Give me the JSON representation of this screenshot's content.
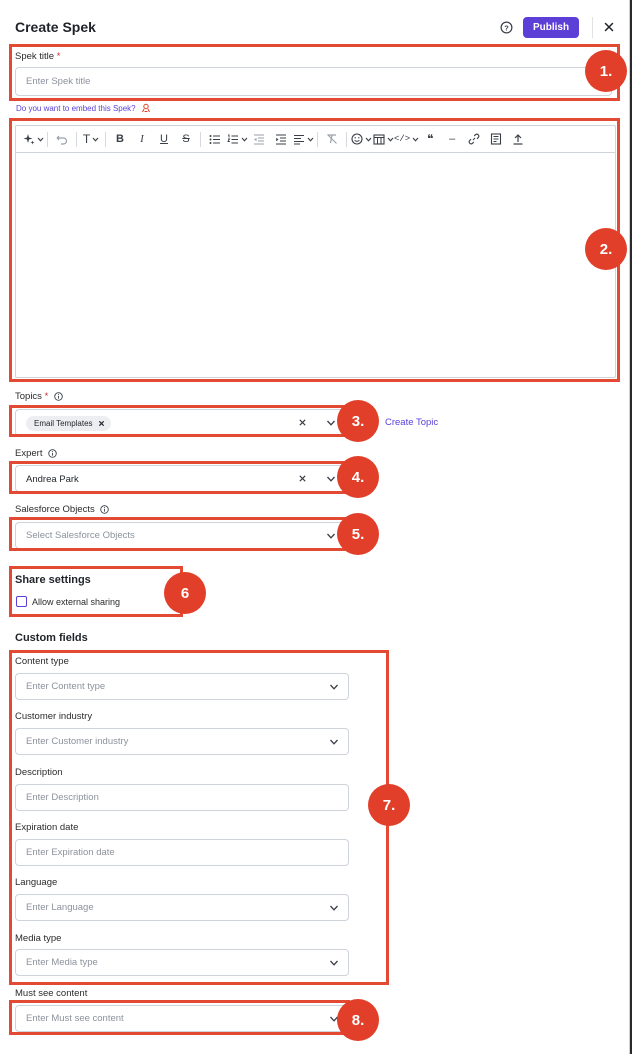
{
  "header": {
    "title": "Create Spek",
    "publish_label": "Publish"
  },
  "spek_title": {
    "label": "Spek title",
    "required_mark": "*",
    "placeholder": "Enter Spek title",
    "embed_link": "Do you want to embed this Spek?"
  },
  "editor": {
    "toolbar_icons": [
      "ai-sparkle-icon",
      "undo-icon",
      "text-style-icon",
      "bold-icon",
      "italic-icon",
      "underline-icon",
      "strikethrough-icon",
      "bullet-list-icon",
      "numbered-list-icon",
      "outdent-icon",
      "indent-icon",
      "align-icon",
      "clear-format-icon",
      "emoji-icon",
      "table-icon",
      "code-icon",
      "quote-icon",
      "horizontal-rule-icon",
      "link-icon",
      "template-icon",
      "upload-icon"
    ],
    "text_style_glyph": "T",
    "bold_glyph": "B",
    "italic_glyph": "I",
    "underline_glyph": "U",
    "strike_glyph": "S",
    "code_glyph": "</>",
    "quote_glyph": "❝",
    "hr_glyph": "–"
  },
  "topics": {
    "label": "Topics",
    "required_mark": "*",
    "chips": [
      "Email Templates"
    ],
    "create_topic": "Create Topic"
  },
  "expert": {
    "label": "Expert",
    "value": "Andrea Park"
  },
  "salesforce": {
    "label": "Salesforce Objects",
    "placeholder": "Select Salesforce Objects"
  },
  "share": {
    "title": "Share settings",
    "checkbox_label": "Allow external sharing",
    "checked": false
  },
  "custom_fields": {
    "title": "Custom fields",
    "fields": [
      {
        "label": "Content type",
        "placeholder": "Enter Content type",
        "type": "select"
      },
      {
        "label": "Customer industry",
        "placeholder": "Enter Customer industry",
        "type": "select"
      },
      {
        "label": "Description",
        "placeholder": "Enter Description",
        "type": "text"
      },
      {
        "label": "Expiration date",
        "placeholder": "Enter Expiration date",
        "type": "text"
      },
      {
        "label": "Language",
        "placeholder": "Enter Language",
        "type": "select"
      },
      {
        "label": "Media type",
        "placeholder": "Enter Media type",
        "type": "select"
      }
    ]
  },
  "must_see": {
    "label": "Must see content",
    "placeholder": "Enter Must see content"
  },
  "annotations": {
    "badges": [
      "1.",
      "2.",
      "3.",
      "4.",
      "5.",
      "6",
      "7.",
      "8."
    ],
    "color": "#e23f2a"
  },
  "colors": {
    "accent": "#5b3fd6",
    "annotation": "#e23f2a"
  }
}
